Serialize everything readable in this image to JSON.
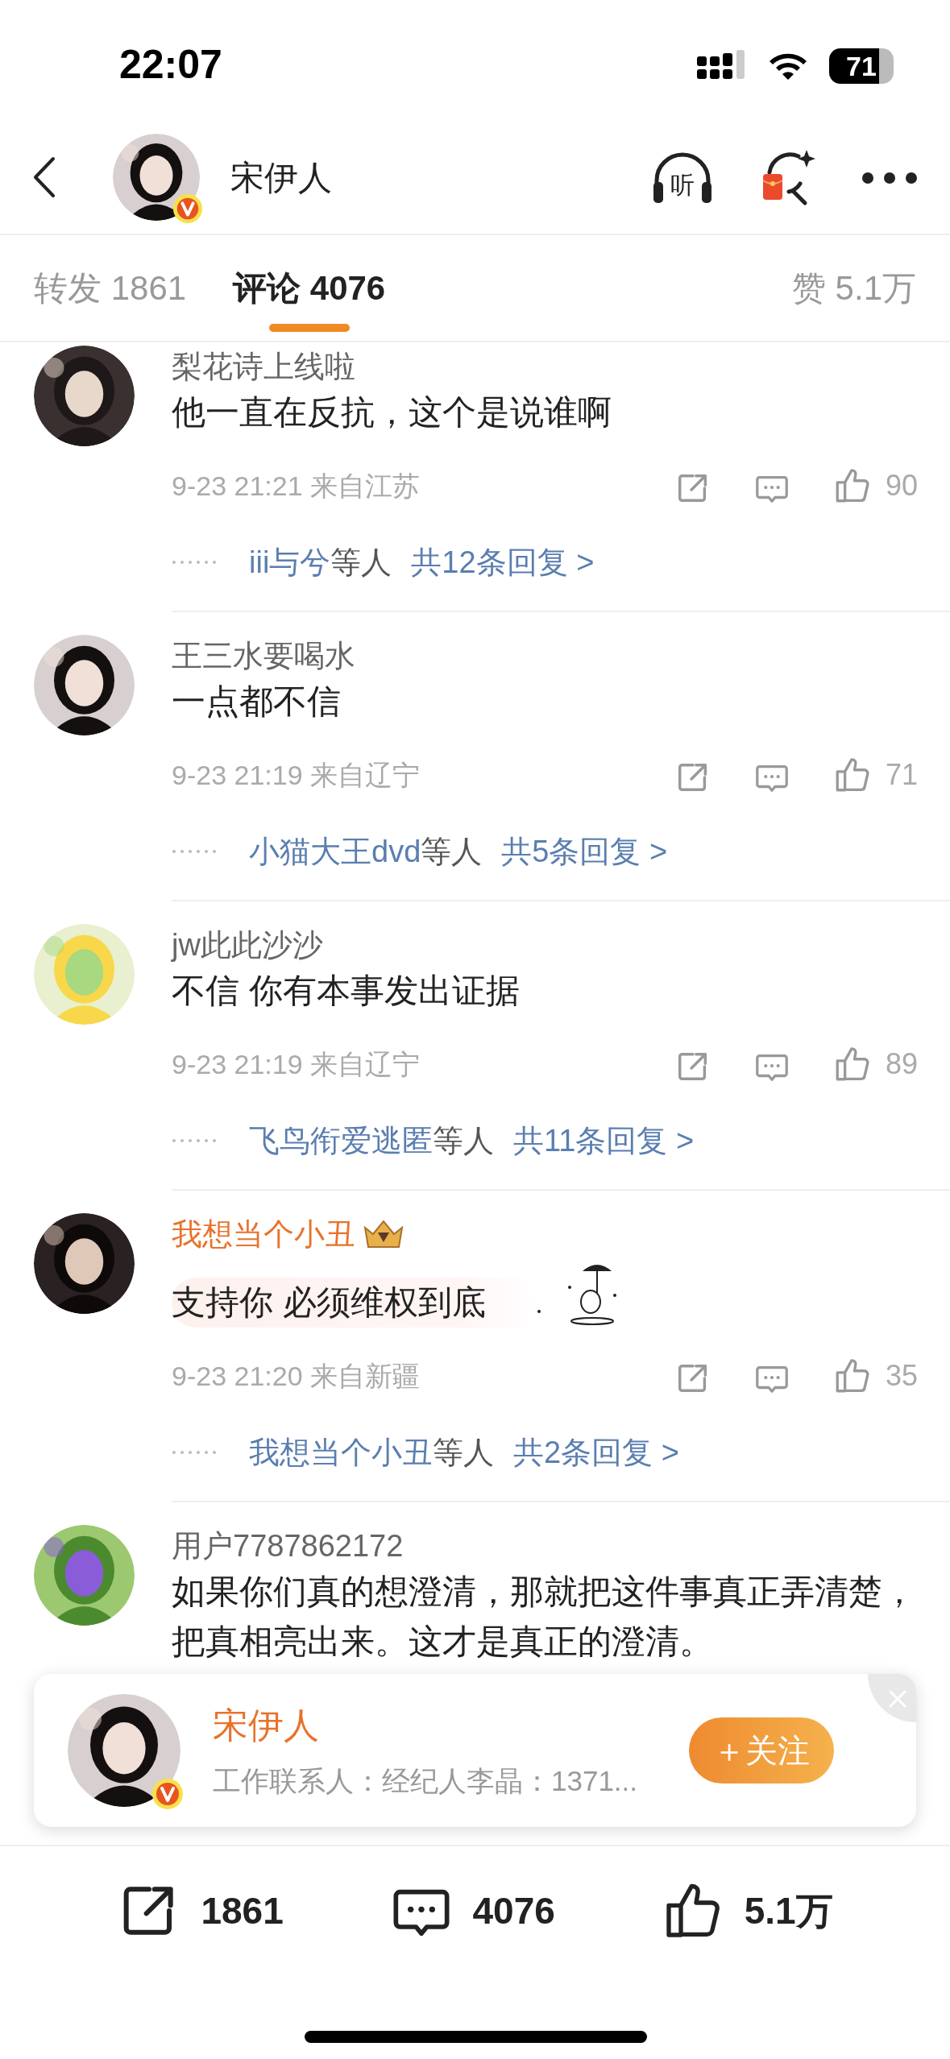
{
  "status_bar": {
    "time": "22:07",
    "battery": "71"
  },
  "header": {
    "name": "宋伊人",
    "verified": true,
    "listen_label": "听"
  },
  "tabs": [
    {
      "label": "转发 1861",
      "selected": false
    },
    {
      "label": "评论 4076",
      "selected": true
    }
  ],
  "likes_tab": "赞 5.1万",
  "comments": [
    {
      "user": "梨花诗上线啦",
      "vip": false,
      "bubble": false,
      "text": "他一直在反抗，这个是说谁啊",
      "time": "9-23 21:21",
      "location": "来自江苏",
      "likes": "90",
      "replies": {
        "names": "iii与兮",
        "suffix": "等人",
        "total": "共12条回复 >"
      }
    },
    {
      "user": "王三水要喝水",
      "vip": false,
      "bubble": false,
      "text": "一点都不信",
      "time": "9-23 21:19",
      "location": "来自辽宁",
      "likes": "71",
      "replies": {
        "names": "小猫大王dvd",
        "suffix": "等人",
        "total": "共5条回复 >"
      }
    },
    {
      "user": "jw此此沙沙",
      "vip": false,
      "bubble": false,
      "text": "不信 你有本事发出证据",
      "time": "9-23 21:19",
      "location": "来自辽宁",
      "likes": "89",
      "replies": {
        "names": "飞鸟衔爱逃匿",
        "suffix": "等人",
        "total": "共11条回复 >"
      }
    },
    {
      "user": "我想当个小丑",
      "vip": true,
      "bubble": true,
      "text": "支持你 必须维权到底",
      "time": "9-23 21:20",
      "location": "来自新疆",
      "likes": "35",
      "replies": {
        "names": "我想当个小丑",
        "suffix": "等人",
        "total": "共2条回复 >"
      }
    },
    {
      "user": "用户7787862172",
      "vip": false,
      "bubble": false,
      "text": "如果你们真的想澄清，那就把这件事真正弄清楚，把真相亮出来。这才是真正的澄清。"
    }
  ],
  "follow_card": {
    "name": "宋伊人",
    "verified": true,
    "description": "工作联系人：经纪人李晶：1371...",
    "button": "＋关注"
  },
  "bottom_bar": [
    {
      "kind": "repost",
      "count": "1861"
    },
    {
      "kind": "comment",
      "count": "4076"
    },
    {
      "kind": "like",
      "count": "5.1万"
    }
  ]
}
